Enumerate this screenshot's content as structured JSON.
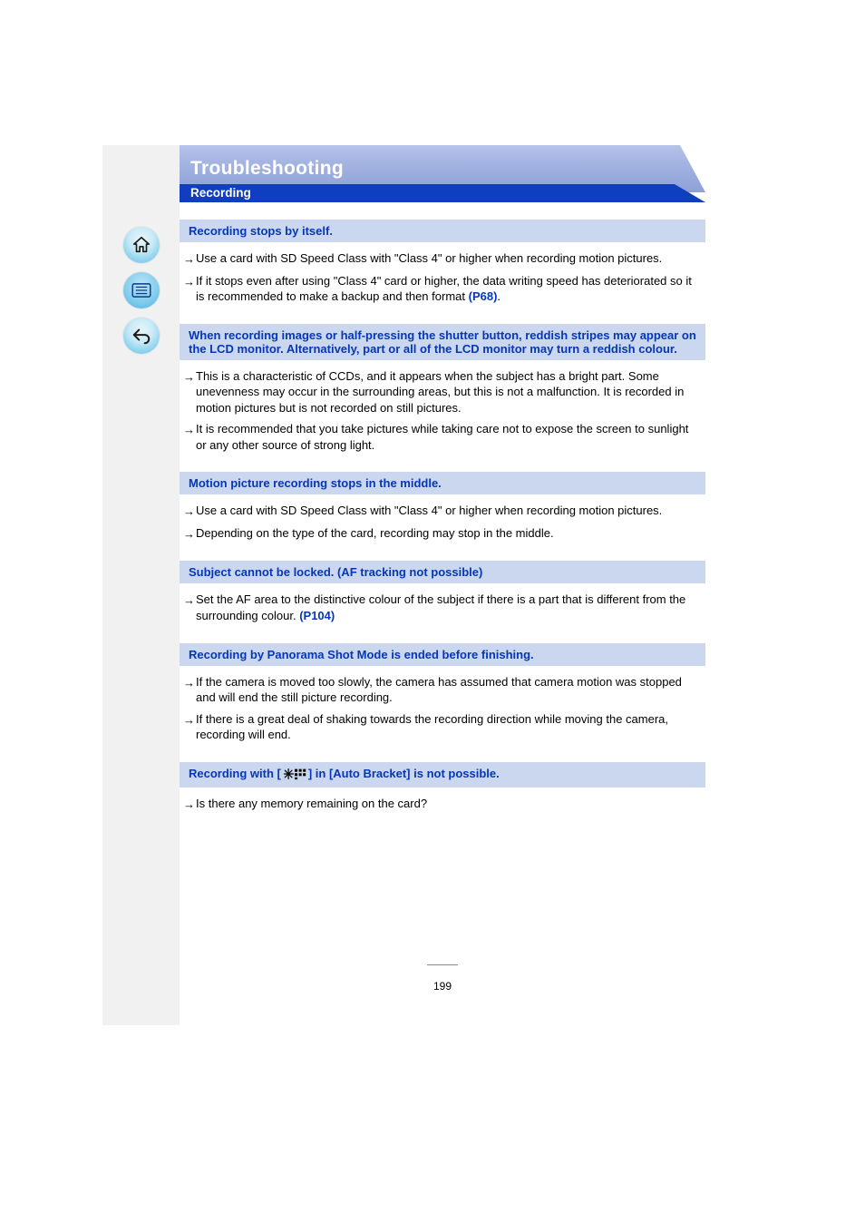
{
  "header": {
    "title": "Troubleshooting",
    "subtitle": "Recording"
  },
  "sidebar": {
    "home_name": "home-icon",
    "list_name": "list-icon",
    "back_name": "back-icon"
  },
  "qa": [
    {
      "question": "Recording stops by itself.",
      "answers": [
        {
          "text": "Use a card with SD Speed Class with \"Class 4\" or higher when recording motion pictures."
        },
        {
          "text": "If it stops even after using \"Class 4\" card or higher, the data writing speed has deteriorated so it is recommended to make a backup and then format ",
          "link": "(P68)",
          "after": "."
        }
      ]
    },
    {
      "question": "When recording images or half-pressing the shutter button, reddish stripes may appear on the LCD monitor. Alternatively, part or all of the LCD monitor may turn a reddish colour.",
      "answers": [
        {
          "text": "This is a characteristic of CCDs, and it appears when the subject has a bright part. Some unevenness may occur in the surrounding areas, but this is not a malfunction. It is recorded in motion pictures but is not recorded on still pictures."
        },
        {
          "text": "It is recommended that you take pictures while taking care not to expose the screen to sunlight or any other source of strong light."
        }
      ]
    },
    {
      "question": "Motion picture recording stops in the middle.",
      "answers": [
        {
          "text": "Use a card with SD Speed Class with \"Class 4\" or higher when recording motion pictures."
        },
        {
          "text": "Depending on the type of the card, recording may stop in the middle."
        }
      ]
    },
    {
      "question": "Subject cannot be locked. (AF tracking not possible)",
      "answers": [
        {
          "text": "Set the AF area to the distinctive colour of the subject if there is a part that is different from the surrounding colour. ",
          "link": "(P104)"
        }
      ]
    },
    {
      "question": "Recording by Panorama Shot Mode is ended before finishing.",
      "answers": [
        {
          "text": "If the camera is moved too slowly, the camera has assumed that camera motion was stopped and will end the still picture recording."
        },
        {
          "text": "If there is a great deal of shaking towards the recording direction while moving the camera, recording will end."
        }
      ]
    },
    {
      "question_prefix": "Recording with [",
      "question_suffix": "] in [Auto Bracket] is not possible.",
      "answers": [
        {
          "text": "Is there any memory remaining on the card?"
        }
      ]
    }
  ],
  "icon_label": "burst-bracket-icon",
  "page_number": "199"
}
